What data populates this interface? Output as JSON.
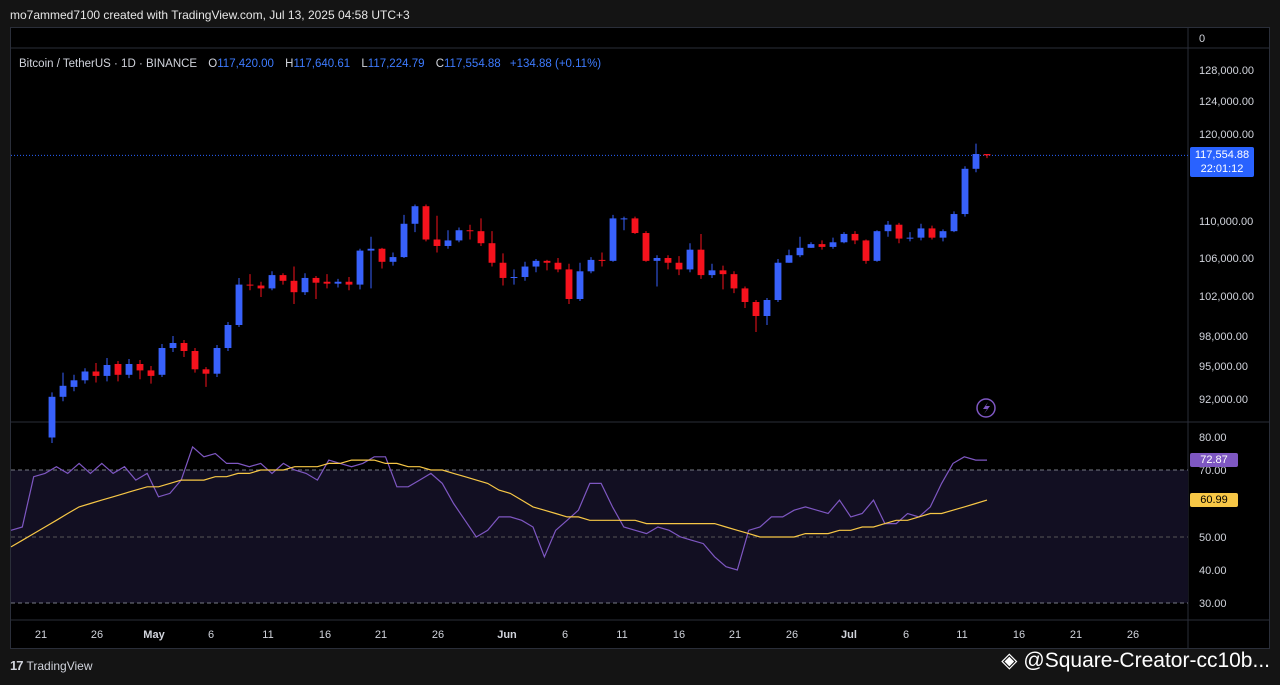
{
  "header": {
    "credit": "mo7ammed7100 created with TradingView.com, Jul 13, 2025 04:58 UTC+3"
  },
  "legend": {
    "symbol": "Bitcoin / TetherUS · 1D · BINANCE",
    "o_label": "O",
    "o": "117,420.00",
    "h_label": "H",
    "h": "117,640.61",
    "l_label": "L",
    "l": "117,224.79",
    "c_label": "C",
    "c": "117,554.88",
    "change": "+134.88 (+0.11%)"
  },
  "price_tag": {
    "price": "117,554.88",
    "countdown": "22:01:12"
  },
  "rsi_tags": {
    "rsi": "72.87",
    "ma": "60.99"
  },
  "footer": {
    "brand": "TradingView"
  },
  "watermark": {
    "text": "@Square-Creator-cc10b..."
  },
  "colors": {
    "up": "#3861fb",
    "down": "#f6121d",
    "rsi": "#7e57c2",
    "rsi_ma": "#f7c746",
    "grid": "#2a2e39"
  },
  "chart_data": {
    "type": "candlestick",
    "price_axis": {
      "ticks": [
        "128,000.00",
        "124,000.00",
        "120,000.00",
        "110,000.00",
        "106,000.00",
        "102,000.00",
        "98,000.00",
        "95,000.00",
        "92,000.00"
      ],
      "top_label": "0"
    },
    "rsi_axis": {
      "ticks": [
        "80.00",
        "70.00",
        "50.00",
        "40.00",
        "30.00"
      ],
      "ylim": [
        30,
        80
      ],
      "bands": [
        70,
        30
      ],
      "mid": 50
    },
    "x_ticks": [
      "21",
      "26",
      "May",
      "6",
      "11",
      "16",
      "21",
      "26",
      "Jun",
      "6",
      "11",
      "16",
      "21",
      "26",
      "Jul",
      "6",
      "11",
      "16",
      "21",
      "26"
    ],
    "candles": [
      [
        88500,
        92200,
        88000,
        92600
      ],
      [
        92200,
        93200,
        91800,
        94400
      ],
      [
        93100,
        93700,
        92700,
        94200
      ],
      [
        93700,
        94500,
        93400,
        94800
      ],
      [
        94500,
        94100,
        93500,
        95300
      ],
      [
        94100,
        95100,
        93600,
        95800
      ],
      [
        95200,
        94200,
        93600,
        95500
      ],
      [
        94200,
        95200,
        93900,
        95700
      ],
      [
        95200,
        94600,
        93800,
        95600
      ],
      [
        94600,
        94100,
        93400,
        95000
      ],
      [
        94200,
        96800,
        94000,
        97200
      ],
      [
        96800,
        97300,
        96400,
        98000
      ],
      [
        97300,
        96500,
        95900,
        97600
      ],
      [
        96500,
        94700,
        94400,
        96800
      ],
      [
        94700,
        94300,
        93100,
        94900
      ],
      [
        94300,
        96800,
        94000,
        97100
      ],
      [
        96800,
        99100,
        96500,
        99400
      ],
      [
        99100,
        103200,
        98900,
        103900
      ],
      [
        103200,
        103100,
        102600,
        104300
      ],
      [
        103100,
        102800,
        101900,
        103500
      ],
      [
        102800,
        104200,
        102600,
        104600
      ],
      [
        104200,
        103600,
        103200,
        104400
      ],
      [
        103600,
        102400,
        101200,
        105100
      ],
      [
        102400,
        103900,
        102100,
        104400
      ],
      [
        103900,
        103400,
        101700,
        104100
      ],
      [
        103500,
        103300,
        102800,
        104300
      ],
      [
        103300,
        103500,
        102900,
        103800
      ],
      [
        103500,
        103200,
        102600,
        104000
      ],
      [
        103200,
        106800,
        102700,
        107000
      ],
      [
        106800,
        107000,
        102800,
        108300
      ],
      [
        107000,
        105600,
        104900,
        107100
      ],
      [
        105600,
        106100,
        105200,
        106600
      ],
      [
        106100,
        109700,
        106000,
        110700
      ],
      [
        109700,
        111700,
        108800,
        111900
      ],
      [
        111700,
        108000,
        107800,
        111900
      ],
      [
        108000,
        107300,
        106600,
        110600
      ],
      [
        107300,
        107900,
        107000,
        109000
      ],
      [
        107900,
        109000,
        107700,
        109300
      ],
      [
        109000,
        108900,
        108000,
        109600
      ],
      [
        108900,
        107600,
        107300,
        110300
      ],
      [
        107600,
        105500,
        105100,
        108900
      ],
      [
        105500,
        103900,
        103100,
        106500
      ],
      [
        103900,
        104000,
        103200,
        104800
      ],
      [
        104000,
        105100,
        103600,
        105600
      ],
      [
        105100,
        105700,
        104500,
        105900
      ],
      [
        105700,
        105500,
        104700,
        105800
      ],
      [
        105500,
        104800,
        104500,
        106000
      ],
      [
        104800,
        101700,
        101200,
        105400
      ],
      [
        101700,
        104600,
        101500,
        105500
      ],
      [
        104600,
        105800,
        104400,
        106100
      ],
      [
        105800,
        105700,
        105100,
        106600
      ],
      [
        105700,
        110300,
        105600,
        110700
      ],
      [
        110300,
        110300,
        109000,
        110500
      ],
      [
        110300,
        108700,
        108600,
        110500
      ],
      [
        108700,
        105700,
        105600,
        108900
      ],
      [
        105700,
        106000,
        103000,
        106300
      ],
      [
        106000,
        105500,
        104800,
        106300
      ],
      [
        105500,
        104800,
        104200,
        106200
      ],
      [
        104800,
        106900,
        104500,
        107600
      ],
      [
        106900,
        104200,
        103800,
        108600
      ],
      [
        104200,
        104700,
        103900,
        105400
      ],
      [
        104700,
        104300,
        102700,
        105200
      ],
      [
        104300,
        102800,
        102300,
        104600
      ],
      [
        102800,
        101400,
        100800,
        103000
      ],
      [
        101400,
        100000,
        98400,
        101600
      ],
      [
        100000,
        101600,
        99100,
        101800
      ],
      [
        101600,
        105500,
        101400,
        105900
      ],
      [
        105500,
        106300,
        106100,
        106900
      ],
      [
        106300,
        107100,
        106100,
        108300
      ],
      [
        107100,
        107500,
        107200,
        107700
      ],
      [
        107500,
        107200,
        106900,
        107900
      ],
      [
        107200,
        107700,
        107000,
        108200
      ],
      [
        107700,
        108600,
        107600,
        108800
      ],
      [
        108600,
        107900,
        107500,
        108900
      ],
      [
        107900,
        105700,
        105400,
        108000
      ],
      [
        105700,
        108900,
        105600,
        109000
      ],
      [
        108900,
        109600,
        108300,
        110000
      ],
      [
        109600,
        108100,
        107600,
        109800
      ],
      [
        108100,
        108200,
        107800,
        108800
      ],
      [
        108200,
        109200,
        107900,
        109700
      ],
      [
        109200,
        108200,
        108000,
        109500
      ],
      [
        108200,
        108900,
        107800,
        109100
      ],
      [
        108900,
        110800,
        108800,
        111100
      ],
      [
        110800,
        116000,
        110500,
        116300
      ],
      [
        116000,
        117700,
        115600,
        118900
      ],
      [
        117700,
        117550,
        117220,
        117640
      ]
    ],
    "rsi": [
      52,
      53,
      68,
      69,
      71,
      69,
      72,
      69,
      72,
      69,
      71,
      67,
      69,
      62,
      63,
      67,
      77,
      74,
      75,
      72,
      72,
      71,
      72,
      69,
      72,
      70,
      69,
      67,
      73,
      72,
      71,
      72,
      74,
      74,
      65,
      65,
      67,
      69,
      66,
      60,
      55,
      50,
      52,
      56,
      56,
      55,
      53,
      44,
      52,
      55,
      58,
      66,
      66,
      59,
      53,
      52,
      51,
      53,
      52,
      50,
      49,
      48,
      44,
      41,
      40,
      52,
      53,
      56,
      56,
      58,
      59,
      58,
      57,
      61,
      56,
      57,
      61,
      54,
      54,
      57,
      56,
      59,
      66,
      72,
      74,
      73,
      73
    ],
    "rsi_ma": [
      47,
      49,
      51,
      53,
      55,
      57,
      59,
      60,
      61,
      62,
      63,
      64,
      65,
      65,
      66,
      67,
      67,
      67,
      68,
      68,
      69,
      69,
      70,
      70,
      70,
      71,
      71,
      71,
      72,
      72,
      73,
      73,
      73,
      72,
      72,
      71,
      71,
      70,
      70,
      69,
      68,
      67,
      66,
      64,
      63,
      61,
      59,
      58,
      57,
      56,
      56,
      55,
      55,
      55,
      55,
      55,
      54,
      54,
      54,
      54,
      54,
      54,
      54,
      53,
      52,
      51,
      50,
      50,
      50,
      50,
      51,
      51,
      51,
      52,
      52,
      53,
      53,
      54,
      55,
      55,
      56,
      57,
      57,
      58,
      59,
      60,
      61
    ]
  }
}
